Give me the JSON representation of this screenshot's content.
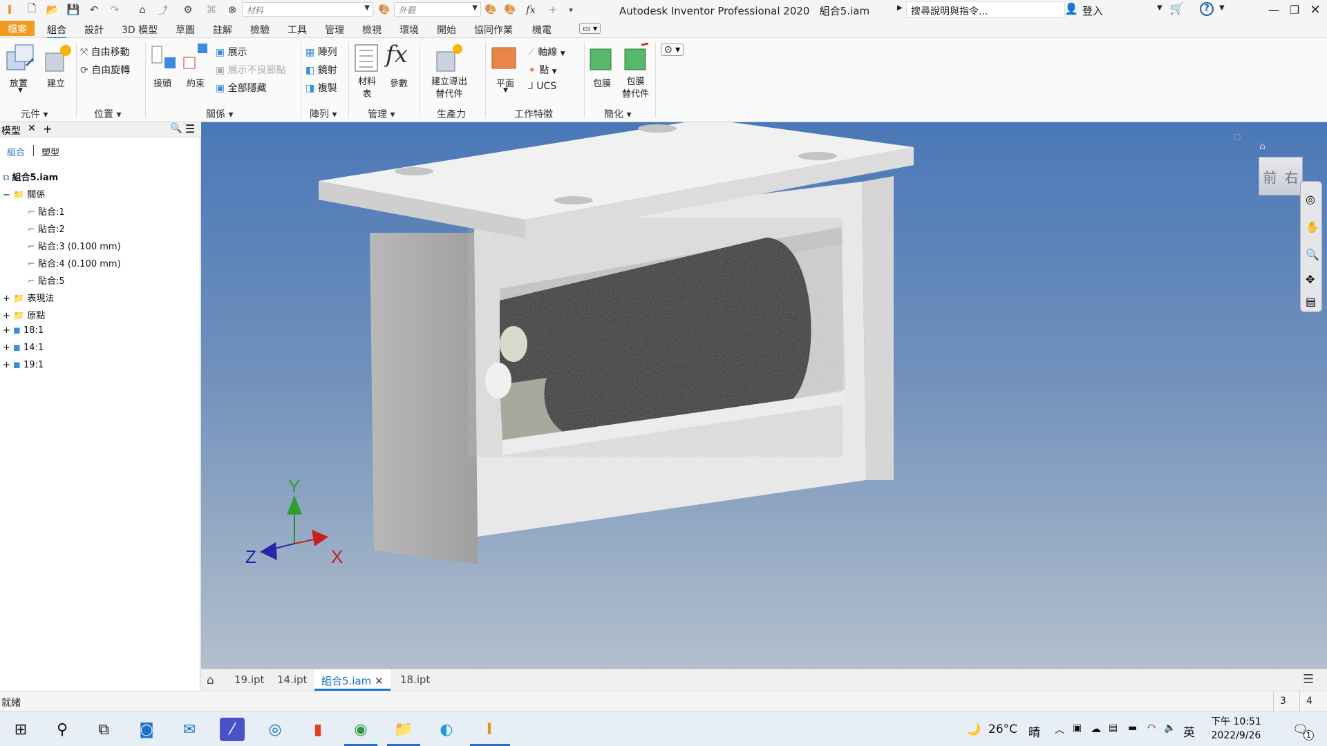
{
  "app": {
    "title": "Autodesk Inventor Professional 2020",
    "document": "組合5.iam",
    "search_placeholder": "搜尋說明與指令...",
    "login": "登入",
    "material_placeholder": "材料",
    "appearance_placeholder": "外觀"
  },
  "menu_tabs": [
    "檔案",
    "組合",
    "設計",
    "3D 模型",
    "草圖",
    "註解",
    "檢驗",
    "工具",
    "管理",
    "檢視",
    "環境",
    "開始",
    "協同作業",
    "機電"
  ],
  "ribbon": {
    "place": "放置",
    "create": "建立",
    "free_move": "自由移動",
    "free_rotate": "自由旋轉",
    "joint": "接頭",
    "constrain": "約束",
    "show": "展示",
    "show_sick": "展示不良節點",
    "hide_all": "全部隱藏",
    "pattern": "陣列",
    "mirror": "鏡射",
    "copy": "複製",
    "bom_line1": "材料",
    "bom_line2": "表",
    "params": "參數",
    "create_sub_line1": "建立導出",
    "create_sub_line2": "替代件",
    "plane": "平面",
    "axis": "軸線",
    "point": "點",
    "ucs": "UCS",
    "shrinkwrap": "包膜",
    "shrinkwrap_sub_line1": "包膜",
    "shrinkwrap_sub_line2": "替代件",
    "groups": {
      "component": "元件",
      "position": "位置",
      "relationships": "關係",
      "pattern": "陣列",
      "manage": "管理",
      "productivity": "生產力",
      "work_features": "工作特徵",
      "simplification": "簡化"
    }
  },
  "panel": {
    "title": "模型",
    "view_assembly": "組合",
    "view_modeling": "塑型",
    "root": "組合5.iam",
    "relationships": "關係",
    "constraints": [
      "貼合:1",
      "貼合:2",
      "貼合:3 (0.100 mm)",
      "貼合:4 (0.100 mm)",
      "貼合:5"
    ],
    "representations": "表現法",
    "origin": "原點",
    "components": [
      "18:1",
      "14:1",
      "19:1"
    ]
  },
  "viewcube": {
    "front": "前",
    "right": "右"
  },
  "triad": {
    "x": "X",
    "y": "Y",
    "z": "Z"
  },
  "doc_tabs": [
    "19.ipt",
    "14.ipt",
    "組合5.iam",
    "18.ipt"
  ],
  "status": {
    "text": "就緒",
    "count_a": "3",
    "count_b": "4"
  },
  "taskbar": {
    "temperature": "26°C",
    "weather": "晴",
    "ime": "英",
    "time": "下午 10:51",
    "date": "2022/9/26",
    "notifications": "1"
  },
  "colors": {
    "accent": "#1a73c8",
    "file_tab": "#f39a1e",
    "viewport_top": "#4a78b8",
    "viewport_bottom": "#b3bfcc"
  }
}
